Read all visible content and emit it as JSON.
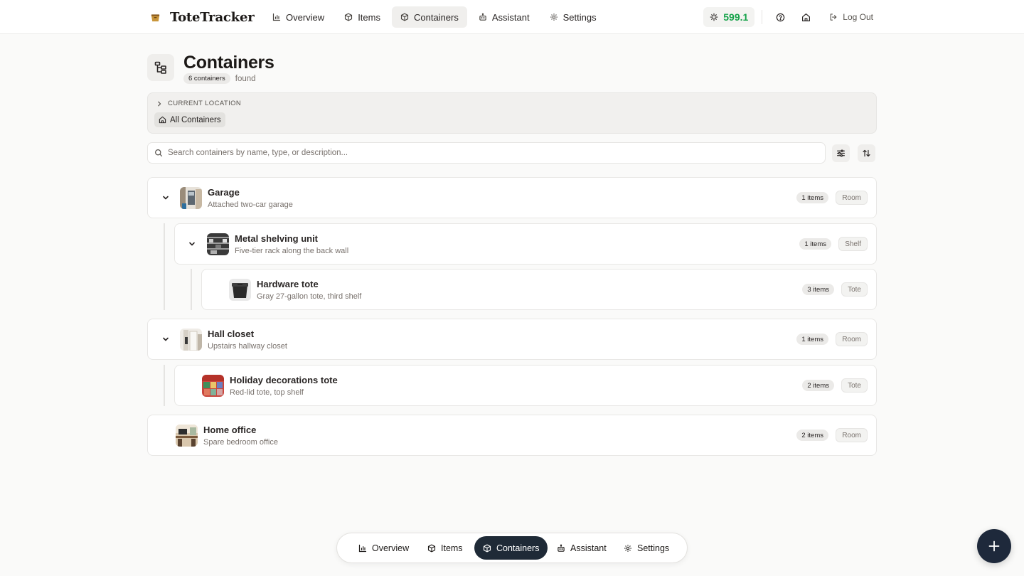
{
  "brand": {
    "name": "ToteTracker"
  },
  "nav": {
    "items": [
      {
        "label": "Overview",
        "icon": "bar-chart-icon"
      },
      {
        "label": "Items",
        "icon": "box-icon"
      },
      {
        "label": "Containers",
        "icon": "box-icon",
        "active": true
      },
      {
        "label": "Assistant",
        "icon": "bot-icon"
      },
      {
        "label": "Settings",
        "icon": "gear-icon"
      }
    ],
    "score": "599.1",
    "logout_label": "Log Out"
  },
  "header": {
    "title": "Containers",
    "count_label": "6 containers",
    "found_label": "found"
  },
  "location": {
    "label": "CURRENT LOCATION",
    "chip_label": "All Containers"
  },
  "search": {
    "placeholder": "Search containers by name, type, or description...",
    "value": ""
  },
  "tree": {
    "rows": [
      {
        "title": "Garage",
        "description": "Attached two-car garage",
        "items": "1 items",
        "type": "Room"
      },
      {
        "title": "Metal shelving unit",
        "description": "Five-tier rack along the back wall",
        "items": "1 items",
        "type": "Shelf"
      },
      {
        "title": "Hardware tote",
        "description": "Gray 27-gallon tote, third shelf",
        "items": "3 items",
        "type": "Tote"
      },
      {
        "title": "Hall closet",
        "description": "Upstairs hallway closet",
        "items": "1 items",
        "type": "Room"
      },
      {
        "title": "Holiday decorations tote",
        "description": "Red-lid tote, top shelf",
        "items": "2 items",
        "type": "Tote"
      },
      {
        "title": "Home office",
        "description": "Spare bedroom office",
        "items": "2 items",
        "type": "Room"
      }
    ]
  },
  "bottom_nav": {
    "items": [
      {
        "label": "Overview"
      },
      {
        "label": "Items"
      },
      {
        "label": "Containers",
        "active": true
      },
      {
        "label": "Assistant"
      },
      {
        "label": "Settings"
      }
    ]
  },
  "colors": {
    "accent_dark": "#1f2a37",
    "score_green": "#16a34a",
    "background": "#fafaf9"
  }
}
